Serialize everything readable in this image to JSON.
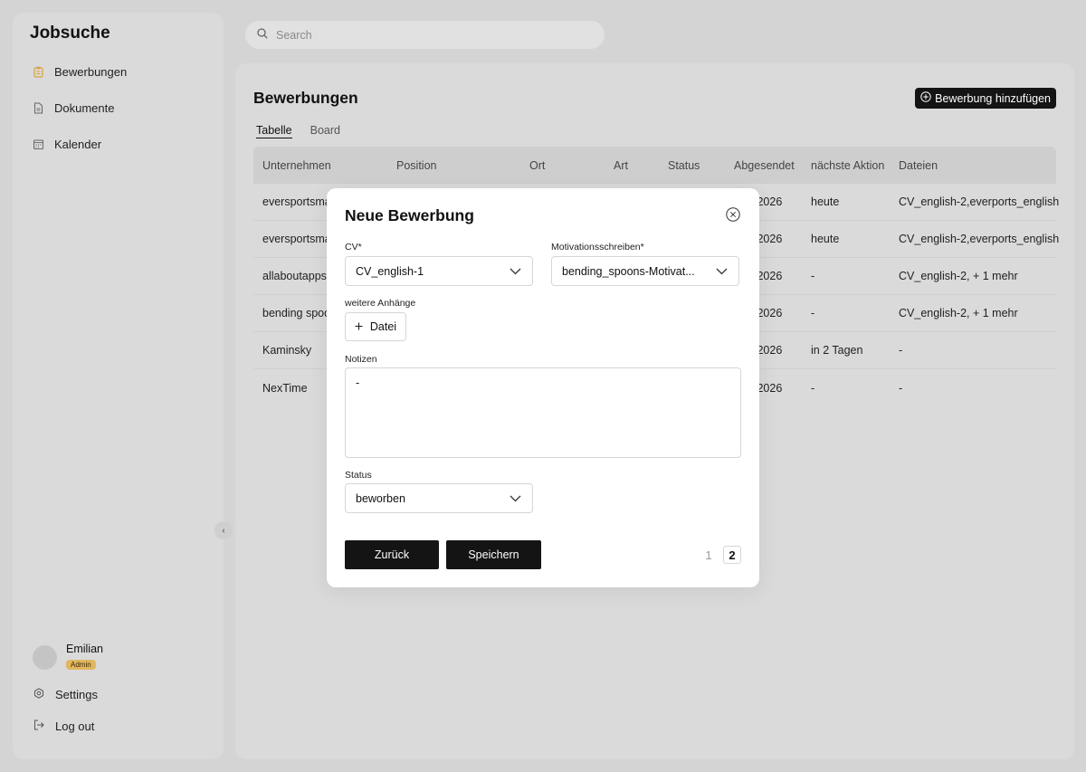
{
  "app": {
    "title": "Jobsuche"
  },
  "sidebar": {
    "items": [
      {
        "label": "Bewerbungen",
        "icon": "clipboard-icon"
      },
      {
        "label": "Dokumente",
        "icon": "document-icon"
      },
      {
        "label": "Kalender",
        "icon": "calendar-icon"
      }
    ],
    "user": {
      "name": "Emilian",
      "role": "Admin"
    },
    "settings_label": "Settings",
    "logout_label": "Log out"
  },
  "search": {
    "placeholder": "Search"
  },
  "main": {
    "title": "Bewerbungen",
    "add_button_label": "Bewerbung hinzufügen",
    "tabs": [
      {
        "label": "Tabelle"
      },
      {
        "label": "Board"
      }
    ],
    "table": {
      "columns": [
        "Unternehmen",
        "Position",
        "Ort",
        "Art",
        "Status",
        "Abgesendet",
        "nächste Aktion",
        "Dateien"
      ],
      "rows": [
        {
          "company": "eversportsma",
          "sent": ".2026",
          "next": "heute",
          "files": "CV_english-2,everports_english"
        },
        {
          "company": "eversportsma",
          "sent": ".2026",
          "next": "heute",
          "files": "CV_english-2,everports_english"
        },
        {
          "company": "allaboutapps",
          "sent": ".2026",
          "next": "-",
          "files": "CV_english-2, + 1 mehr"
        },
        {
          "company": "bending spoo",
          "sent": ".2026",
          "next": "-",
          "files": "CV_english-2, + 1 mehr"
        },
        {
          "company": "Kaminsky",
          "sent": ".2026",
          "next": "in 2 Tagen",
          "files": "-"
        },
        {
          "company": "NexTime",
          "sent": ".2026",
          "next": "-",
          "files": "-"
        }
      ]
    }
  },
  "modal": {
    "title": "Neue Bewerbung",
    "cv_label": "CV*",
    "cv_value": "CV_english-1",
    "motivation_label": "Motivationsschreiben*",
    "motivation_value": "bending_spoons-Motivat...",
    "attachments_label": "weitere Anhänge",
    "file_button_label": "Datei",
    "notes_label": "Notizen",
    "notes_value": "-",
    "status_label": "Status",
    "status_value": "beworben",
    "back_label": "Zurück",
    "save_label": "Speichern",
    "pages": [
      "1",
      "2"
    ],
    "current_page": "2"
  },
  "colors": {
    "accent": "#e2b660",
    "dark_button": "#141414",
    "background": "#d4d4d4"
  }
}
